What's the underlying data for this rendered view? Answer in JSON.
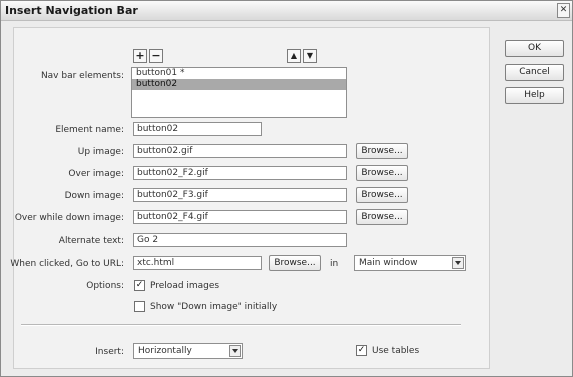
{
  "window": {
    "title": "Insert Navigation Bar",
    "close_glyph": "✕"
  },
  "toolbar": {
    "add_glyph": "+",
    "remove_glyph": "−",
    "up_glyph": "▲",
    "down_glyph": "▼"
  },
  "nav_elements": {
    "label": "Nav bar elements:",
    "items": [
      "button01 *",
      "button02"
    ],
    "selected_index": 1
  },
  "fields": {
    "element_name": {
      "label": "Element name:",
      "value": "button02"
    },
    "up_image": {
      "label": "Up image:",
      "value": "button02.gif"
    },
    "over_image": {
      "label": "Over image:",
      "value": "button02_F2.gif"
    },
    "down_image": {
      "label": "Down image:",
      "value": "button02_F3.gif"
    },
    "over_while_down": {
      "label": "Over while down image:",
      "value": "button02_F4.gif"
    },
    "alternate_text": {
      "label": "Alternate text:",
      "value": "Go 2"
    },
    "url": {
      "label": "When clicked, Go to URL:",
      "value": "xtc.html",
      "in_label": "in",
      "target": "Main window"
    }
  },
  "browse_label": "Browse...",
  "options": {
    "label": "Options:",
    "preload": {
      "label": "Preload images",
      "checked": true
    },
    "show_down": {
      "label": "Show \"Down image\" initially",
      "checked": false
    }
  },
  "insert": {
    "label": "Insert:",
    "value": "Horizontally"
  },
  "use_tables": {
    "label": "Use tables",
    "checked": true
  },
  "check_glyph": "✓",
  "buttons": {
    "ok": "OK",
    "cancel": "Cancel",
    "help": "Help"
  }
}
